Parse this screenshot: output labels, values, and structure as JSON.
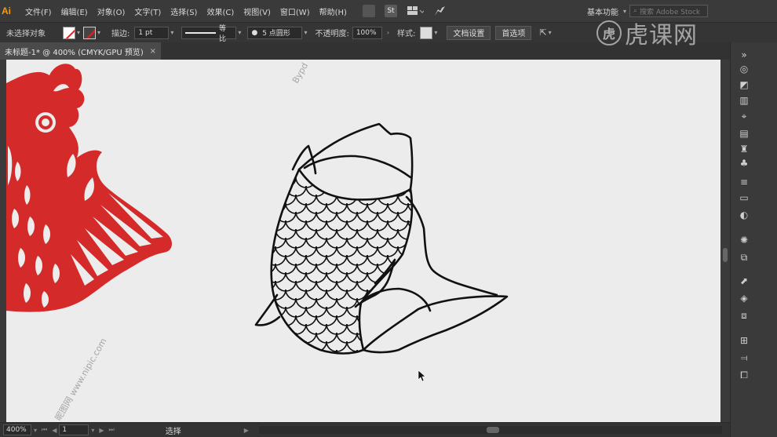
{
  "menubar": {
    "logo": "Ai",
    "items": [
      "文件(F)",
      "编辑(E)",
      "对象(O)",
      "文字(T)",
      "选择(S)",
      "效果(C)",
      "视图(V)",
      "窗口(W)",
      "帮助(H)"
    ],
    "st_label": "St",
    "workspace": "基本功能",
    "stock_placeholder": "搜索 Adobe Stock"
  },
  "controlbar": {
    "no_selection": "未选择对象",
    "stroke_label": "描边:",
    "stroke_value": "1 pt",
    "profile_label": "等比",
    "brush_label": "5 点圆形",
    "opacity_label": "不透明度:",
    "opacity_value": "100%",
    "style_label": "样式:",
    "doc_setup": "文档设置",
    "preferences": "首选项"
  },
  "tab": {
    "title": "未标题-1* @ 400% (CMYK/GPU 预览)",
    "close": "×"
  },
  "statusbar": {
    "zoom": "400%",
    "artboard": "1",
    "tool": "选择"
  },
  "watermark": {
    "logo_char": "虎",
    "text": "虎课网"
  },
  "canvas_stamps": {
    "top": "Bypd",
    "side": "昵图网 www.nipic.com"
  },
  "colors": {
    "papercut_red": "#d42a2a",
    "canvas_bg": "#ececec",
    "ui_dark": "#3a3a3a"
  }
}
